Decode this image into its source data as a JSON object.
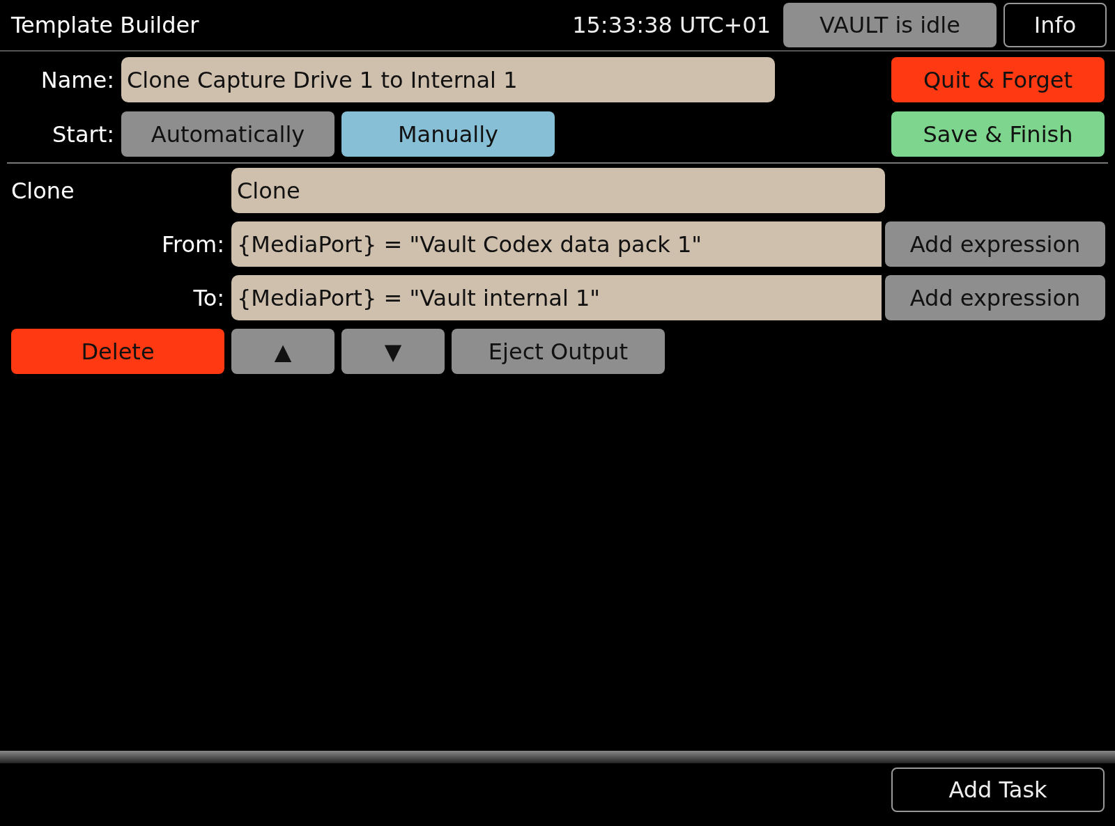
{
  "header": {
    "title": "Template Builder",
    "time": "15:33:38 UTC+01",
    "status_button": "VAULT is idle",
    "info_button": "Info"
  },
  "name_row": {
    "label": "Name:",
    "value": "Clone Capture Drive 1 to Internal 1"
  },
  "start_row": {
    "label": "Start:",
    "options": [
      {
        "label": "Automatically",
        "selected": false
      },
      {
        "label": "Manually",
        "selected": true
      }
    ]
  },
  "actions": [
    {
      "label": "Quit & Forget",
      "kind": "danger"
    },
    {
      "label": "Save & Finish",
      "kind": "confirm"
    }
  ],
  "task": {
    "label": "Clone",
    "value": "Clone",
    "rows": [
      {
        "label": "From:",
        "value": "{MediaPort} = \"Vault Codex data pack 1\"",
        "button": "Add expression"
      },
      {
        "label": "To:",
        "value": "{MediaPort} = \"Vault internal 1\"",
        "button": "Add expression"
      }
    ],
    "buttons": [
      {
        "label": "Delete",
        "kind": "danger"
      },
      {
        "label": "▲",
        "kind": "plain"
      },
      {
        "label": "▼",
        "kind": "plain"
      },
      {
        "label": "Eject Output",
        "kind": "plain"
      }
    ]
  },
  "footer": {
    "add_button": "Add Task"
  }
}
